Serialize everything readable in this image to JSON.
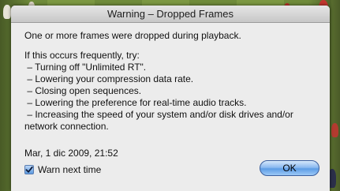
{
  "dialog": {
    "title": "Warning – Dropped Frames",
    "message": "One or more frames were dropped during playback.",
    "help_lines": [
      "If this occurs frequently, try:",
      " – Turning off \"Unlimited RT\".",
      " – Lowering your compression data rate.",
      " – Closing open sequences.",
      " – Lowering the preference for real-time audio tracks.",
      " – Increasing the speed of your system and/or disk drives and/or",
      "network connection."
    ],
    "timestamp": "Mar, 1 dic 2009, 21:52",
    "checkbox": {
      "label": "Warn next time",
      "checked": true,
      "icon": "checkmark-icon"
    },
    "ok_label": "OK"
  },
  "colors": {
    "dialog_bg": "#ececec",
    "button_accent": "#5e9de6"
  }
}
